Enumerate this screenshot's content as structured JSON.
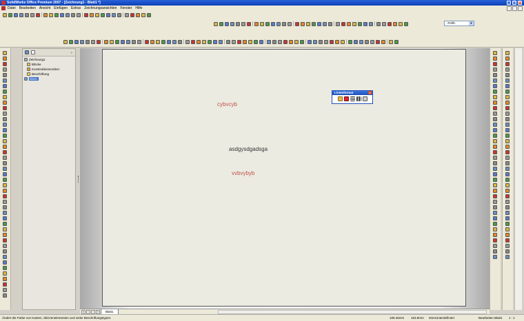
{
  "window": {
    "title": "SolidWorks Office Premium 2007 - [Zeichnung1 - Blatt1 *]"
  },
  "menu": {
    "items": [
      "Datei",
      "Bearbeiten",
      "Ansicht",
      "Einfügen",
      "Extras",
      "Zeichnungsansichten",
      "Fenster",
      "Hilfe"
    ]
  },
  "toolbar": {
    "layer_select": "-Fehlt-"
  },
  "tree": {
    "items": [
      {
        "label": "Zeichnung1",
        "icon": "drawing-icon"
      },
      {
        "label": "Blöcke",
        "icon": "blocks-folder-icon"
      },
      {
        "label": "Konstruktionsordner",
        "icon": "design-folder-icon"
      },
      {
        "label": "Beschriftung",
        "icon": "annotation-icon"
      },
      {
        "label": "Blatt1",
        "icon": "sheet-icon"
      }
    ]
  },
  "sheet": {
    "texts": [
      {
        "value": "cybvcyb",
        "color": "#c0504d"
      },
      {
        "value": "asdgysdgadsga",
        "color": "#333333"
      },
      {
        "value": "vvbvybyb",
        "color": "#c0504d"
      }
    ]
  },
  "palette": {
    "title": "Linienformat"
  },
  "tabs": {
    "sheet_tab": "Blatt1"
  },
  "status": {
    "hint": "Ändert die Farbe von Kanten, Skizzenelementen und vieler Beschriftungstypen.",
    "x": "109.45mm",
    "y": "163.8mm",
    "z": "0mm",
    "state": "Unterdefiniert",
    "editing": "Bearbeiten Blatt1",
    "scale": "1 : 1"
  },
  "colors": {
    "title_blue": "#0a3fb8",
    "tree_selected": "#316ac5",
    "accent_red": "#c0504d"
  }
}
